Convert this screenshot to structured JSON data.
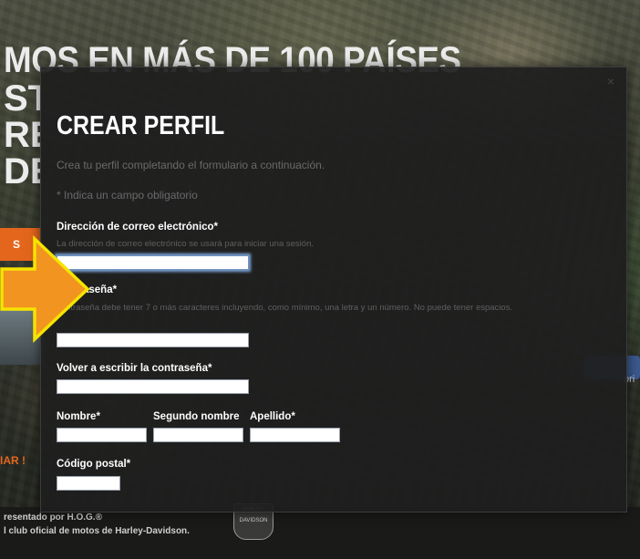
{
  "background": {
    "headline": "MOS EN MÁS DE 100 PAÍSES",
    "side_lines": [
      "STI",
      "RE",
      "DE"
    ],
    "orange_button": "S",
    "orange_link": "IAR !",
    "right_text": "ori",
    "footer": {
      "line1": "resentado por H.O.G.®",
      "line2": "l club oficial de motos de Harley-Davidson.",
      "logo_text": "HARLEY-DAVIDSON"
    }
  },
  "modal": {
    "close_icon": "×",
    "title": "CREAR PERFIL",
    "subtitle": "Crea tu perfil completando el formulario a continuación.",
    "required_note": "* Indica un campo obligatorio",
    "fields": {
      "email": {
        "label": "Dirección de correo electrónico*",
        "hint": "La dirección de correo electrónico se usará para iniciar una sesión.",
        "value": ""
      },
      "password": {
        "label": "aseña*",
        "hint": "contraseña debe tener 7 o más caracteres incluyendo, como mínimo, una letra y un número. No puede tener espacios.",
        "value": ""
      },
      "password_confirm": {
        "label": "Volver a escribir la contraseña*",
        "value": ""
      },
      "first_name": {
        "label": "Nombre*",
        "value": ""
      },
      "middle_name": {
        "label": "Segundo nombre",
        "value": ""
      },
      "last_name": {
        "label": "Apellido*",
        "value": ""
      },
      "postal_code": {
        "label": "Código postal*",
        "value": ""
      }
    }
  },
  "annotation": {
    "arrow_icon": "arrow-right-icon",
    "arrow_color": "#F29420",
    "arrow_outline": "#F5E400"
  }
}
